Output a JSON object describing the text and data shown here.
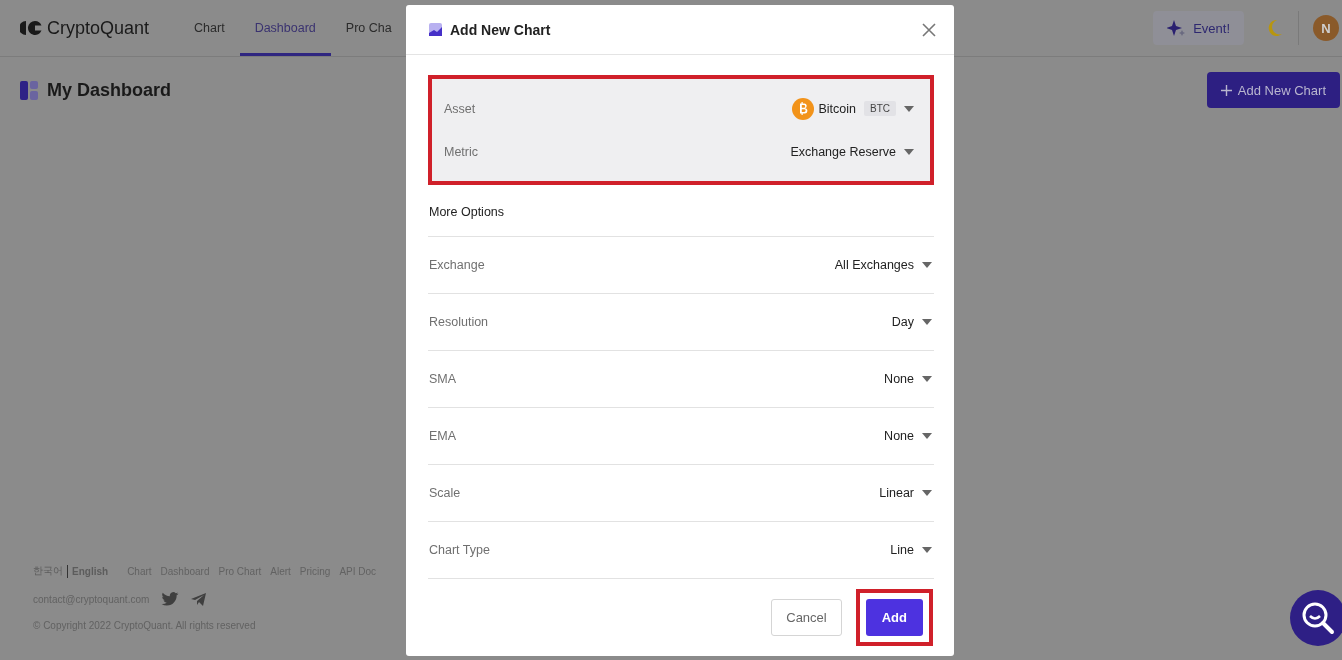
{
  "header": {
    "logo": "CryptoQuant",
    "nav": [
      {
        "label": "Chart",
        "selected": false
      },
      {
        "label": "Dashboard",
        "selected": true
      },
      {
        "label": "Pro Cha",
        "selected": false
      }
    ],
    "event_button": "Event!",
    "avatar": "N"
  },
  "page": {
    "title": "My Dashboard",
    "add_button": "Add New Chart"
  },
  "footer": {
    "languages": [
      {
        "label": "한국어",
        "selected": false
      },
      {
        "label": "English",
        "selected": true
      }
    ],
    "links": [
      "Chart",
      "Dashboard",
      "Pro Chart",
      "Alert",
      "Pricing",
      "API Doc"
    ],
    "email": "contact@cryptoquant.com",
    "copyright": "© Copyright 2022 CryptoQuant. All rights reserved"
  },
  "dialog": {
    "title": "Add New Chart",
    "highlighted": [
      {
        "label": "Asset",
        "value": "Bitcoin",
        "badge": "BTC",
        "kind": "asset"
      },
      {
        "label": "Metric",
        "value": "Exchange Reserve",
        "kind": "plain"
      }
    ],
    "more_options": "More Options",
    "options": [
      {
        "label": "Exchange",
        "value": "All Exchanges"
      },
      {
        "label": "Resolution",
        "value": "Day"
      },
      {
        "label": "SMA",
        "value": "None"
      },
      {
        "label": "EMA",
        "value": "None"
      },
      {
        "label": "Scale",
        "value": "Linear"
      },
      {
        "label": "Chart Type",
        "value": "Line"
      }
    ],
    "buttons": [
      {
        "label": "Cancel",
        "kind": "secondary",
        "highlighted": false
      },
      {
        "label": "Add",
        "kind": "primary",
        "highlighted": true
      }
    ]
  }
}
